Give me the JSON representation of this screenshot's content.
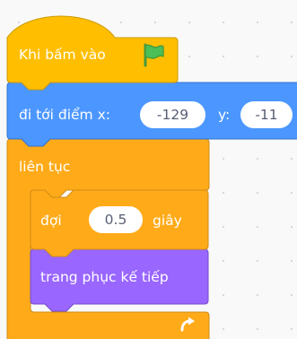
{
  "colors": {
    "events": "#ffbf00",
    "events_border": "#cc9900",
    "motion": "#4c97ff",
    "motion_border": "#3373cc",
    "control": "#ffab19",
    "control_border": "#cf8b17",
    "looks": "#9966ff",
    "looks_border": "#774dcb",
    "flag_green": "#4cbf56",
    "flag_border": "#45993d"
  },
  "script": {
    "hat_block": {
      "label": "Khi bấm vào",
      "icon": "green-flag-icon"
    },
    "goto_block": {
      "label": "đi tới điểm x:",
      "x_value": "-129",
      "y_label": "y:",
      "y_value": "-11"
    },
    "forever_block": {
      "label": "liên tục",
      "icon": "loop-arrow-icon",
      "body": {
        "wait_block": {
          "label": "đợi",
          "value": "0.5",
          "unit": "giây"
        },
        "costume_block": {
          "label": "trang phục kế tiếp"
        }
      }
    }
  }
}
